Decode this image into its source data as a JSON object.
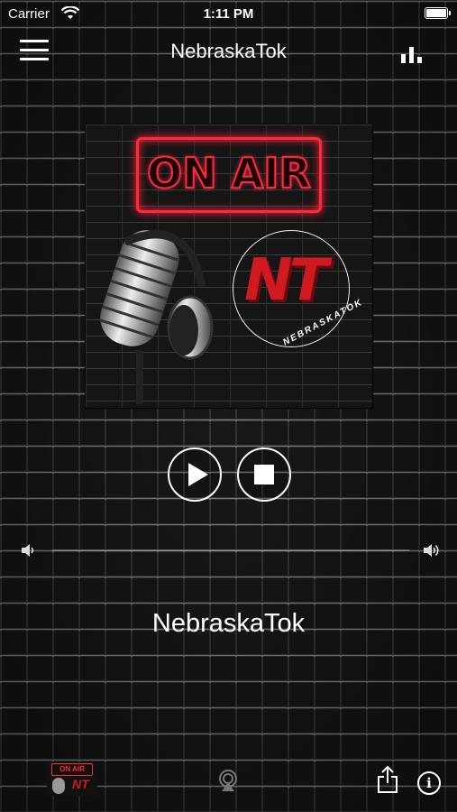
{
  "status_bar": {
    "carrier": "Carrier",
    "time": "1:11 PM",
    "icons": [
      "wifi-icon",
      "battery-icon"
    ]
  },
  "nav": {
    "title": "NebraskaTok",
    "left_icon": "menu-icon",
    "right_icon": "equalizer-icon"
  },
  "artwork": {
    "sign_text": "ON AIR",
    "logo_text": "NT",
    "logo_ring_text": "NEBRASKATOK",
    "accent": "#ff2a3a",
    "logo_red": "#d01a22"
  },
  "player": {
    "play_icon": "play-icon",
    "stop_icon": "stop-icon",
    "volume_low_icon": "speaker-low-icon",
    "volume_high_icon": "speaker-high-icon"
  },
  "station": {
    "name": "NebraskaTok"
  },
  "tab_bar": {
    "thumb_sign": "ON AIR",
    "thumb_logo": "NT",
    "icons": [
      "airplay-icon",
      "share-icon",
      "info-icon"
    ],
    "info_glyph": "i"
  }
}
